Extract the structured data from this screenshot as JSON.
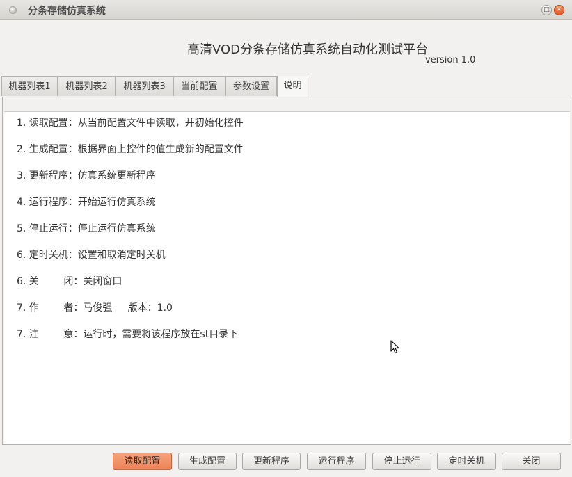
{
  "window": {
    "title": "分条存储仿真系统",
    "max_glyph": "□",
    "close_glyph": "✕"
  },
  "header": {
    "heading": "高清VOD分条存储仿真系统自动化测试平台",
    "version": "version 1.0"
  },
  "tabs": [
    {
      "label": "机器列表1"
    },
    {
      "label": "机器列表2"
    },
    {
      "label": "机器列表3"
    },
    {
      "label": "当前配置"
    },
    {
      "label": "参数设置"
    },
    {
      "label": "说明",
      "active": true
    }
  ],
  "help_lines": [
    "1. 读取配置：从当前配置文件中读取，并初始化控件",
    "2. 生成配置：根据界面上控件的值生成新的配置文件",
    "3. 更新程序：仿真系统更新程序",
    "4. 运行程序：开始运行仿真系统",
    "5. 停止运行：停止运行仿真系统",
    "6. 定时关机：设置和取消定时关机",
    "6. 关        闭：关闭窗口",
    "7. 作        者：马俊强     版本：1.0",
    "7. 注        意：运行时，需要将该程序放在st目录下"
  ],
  "buttons": {
    "read_config": "读取配置",
    "gen_config": "生成配置",
    "update_program": "更新程序",
    "run_program": "运行程序",
    "stop_run": "停止运行",
    "timed_shutdown": "定时关机",
    "close": "关闭"
  },
  "colors": {
    "default_button": "#ed8357",
    "close_button": "#e1541e"
  },
  "icons": [
    "window-menu-icon",
    "maximize-icon",
    "close-icon",
    "mouse-pointer-icon"
  ]
}
